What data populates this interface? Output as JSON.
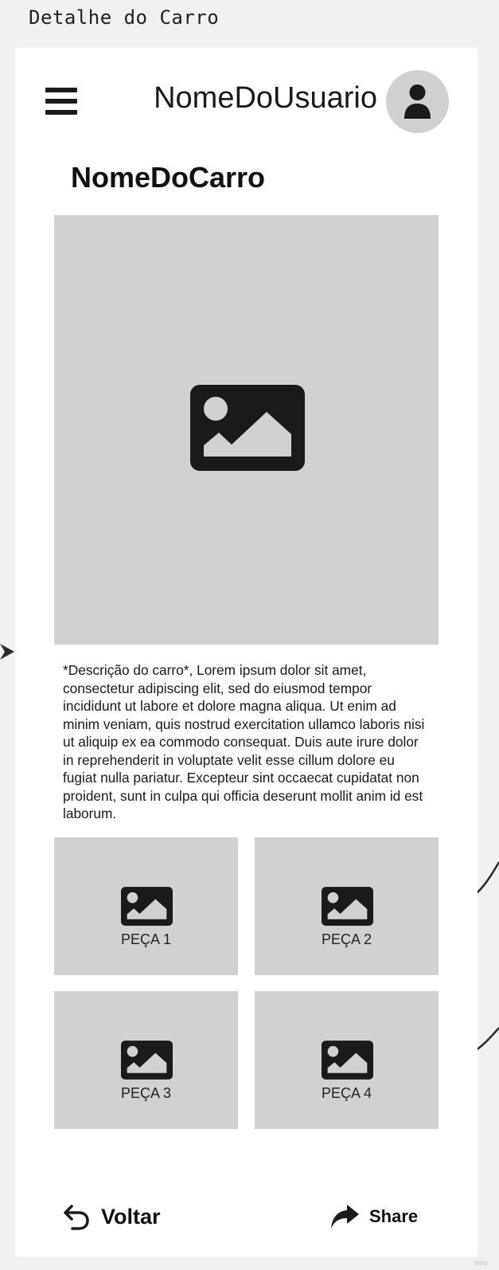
{
  "frame": {
    "title": "Detalhe do Carro"
  },
  "header": {
    "menu_icon": "hamburger-menu-icon",
    "username": "NomeDoUsuario",
    "avatar_icon": "user-icon"
  },
  "car": {
    "name": "NomeDoCarro",
    "image_icon": "image-placeholder-icon",
    "description": "*Descrição do carro*, Lorem ipsum dolor sit amet, consectetur adipiscing elit, sed do eiusmod tempor incididunt ut labore et dolore magna aliqua. Ut enim ad minim veniam, quis nostrud exercitation ullamco laboris nisi ut aliquip ex ea commodo consequat. Duis aute irure dolor in reprehenderit in voluptate velit esse cillum dolore eu fugiat nulla pariatur. Excepteur sint occaecat cupidatat non proident, sunt in culpa qui officia deserunt mollit anim id est laborum."
  },
  "parts": [
    {
      "label": "PEÇA 1"
    },
    {
      "label": "PEÇA 2"
    },
    {
      "label": "PEÇA 3"
    },
    {
      "label": "PEÇA 4"
    }
  ],
  "footer": {
    "back_label": "Voltar",
    "back_icon": "undo-arrow-icon",
    "share_label": "Share",
    "share_icon": "share-arrow-icon"
  },
  "watermark": "miro",
  "colors": {
    "background": "#f1f1f1",
    "card": "#ffffff",
    "placeholder": "#d1d1d1",
    "icon": "#1a1a1a"
  }
}
